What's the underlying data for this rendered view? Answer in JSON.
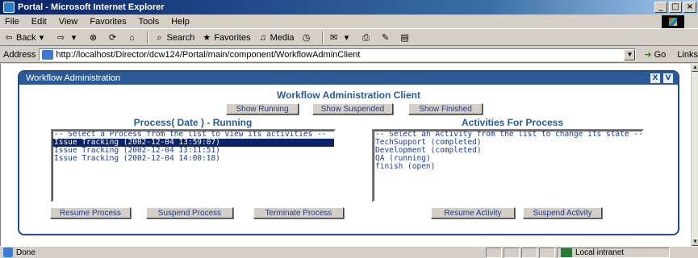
{
  "window": {
    "title": "Portal - Microsoft Internet Explorer",
    "buttons": [
      "_",
      "□",
      "×"
    ]
  },
  "menu": [
    "File",
    "Edit",
    "View",
    "Favorites",
    "Tools",
    "Help"
  ],
  "toolbar": {
    "back": "Back",
    "search": "Search",
    "favorites": "Favorites",
    "media": "Media"
  },
  "address": {
    "label": "Address",
    "url": "http://localhost/Director/dcw124/Portal/main/component/WorkflowAdminClient",
    "go": "Go",
    "links": "Links"
  },
  "panel": {
    "header": "Workflow Administration",
    "header_buttons": [
      "X",
      "V"
    ],
    "client_title": "Workflow Administration Client",
    "filter_buttons": [
      "Show Running",
      "Show Suspended",
      "Show Finished"
    ],
    "process_title": "Process( Date ) - Running",
    "processes": [
      "-- Select a Process from the list to view its activities --",
      "Issue Tracking (2002-12-04 13:59:07)",
      "Issue Tracking (2002-12-04 13:11:51)",
      "Issue Tracking (2002-12-04 14:00:18)"
    ],
    "selected_process_index": 1,
    "activities_title": "Activities For Process",
    "activities": [
      "-- Select an Activity from the list to change its state --",
      "TechSupport (completed)",
      "Development (completed)",
      "QA (running)",
      "finish (open)"
    ],
    "process_buttons": [
      "Resume Process",
      "Suspend Process",
      "Terminate Process"
    ],
    "activity_buttons": [
      "Resume Activity",
      "Suspend Activity"
    ]
  },
  "status": {
    "text": "Done",
    "zone": "Local intranet"
  }
}
